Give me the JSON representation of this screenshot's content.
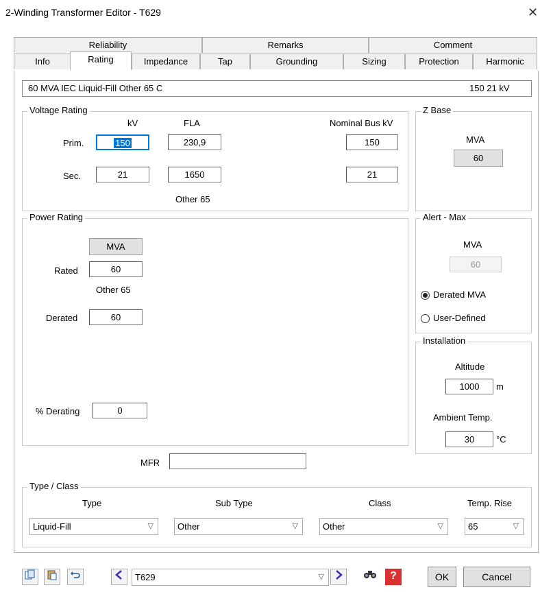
{
  "window": {
    "title": "2-Winding Transformer Editor - T629",
    "close_glyph": "✕"
  },
  "tabs_row1": [
    "Reliability",
    "Remarks",
    "Comment"
  ],
  "tabs_row2": [
    "Info",
    "Rating",
    "Impedance",
    "Tap",
    "Grounding",
    "Sizing",
    "Protection",
    "Harmonic"
  ],
  "summary": {
    "left": "60 MVA  IEC  Liquid-Fill  Other  65 C",
    "right": "150   21 kV"
  },
  "voltage_rating": {
    "title": "Voltage Rating",
    "col_kv": "kV",
    "col_fla": "FLA",
    "col_nominal": "Nominal Bus kV",
    "prim_label": "Prim.",
    "prim_kv": "150",
    "prim_fla": "230,9",
    "prim_nominal": "150",
    "sec_label": "Sec.",
    "sec_kv": "21",
    "sec_fla": "1650",
    "sec_nominal": "21",
    "note": "Other 65"
  },
  "z_base": {
    "title": "Z Base",
    "mva_label": "MVA",
    "mva_value": "60"
  },
  "power_rating": {
    "title": "Power Rating",
    "mva_button": "MVA",
    "rated_label": "Rated",
    "rated_value": "60",
    "note": "Other 65",
    "derated_label": "Derated",
    "derated_value": "60",
    "derating_label": "% Derating",
    "derating_value": "0"
  },
  "alert_max": {
    "title": "Alert - Max",
    "mva_label": "MVA",
    "mva_value": "60",
    "option_derated": "Derated MVA",
    "option_user": "User-Defined"
  },
  "installation": {
    "title": "Installation",
    "altitude_label": "Altitude",
    "altitude_value": "1000",
    "altitude_unit": "m",
    "ambient_label": "Ambient Temp.",
    "ambient_value": "30",
    "ambient_unit": "°C"
  },
  "mfr": {
    "label": "MFR",
    "value": ""
  },
  "type_class": {
    "title": "Type / Class",
    "type_label": "Type",
    "type_value": "Liquid-Fill",
    "subtype_label": "Sub Type",
    "subtype_value": "Other",
    "class_label": "Class",
    "class_value": "Other",
    "temprise_label": "Temp. Rise",
    "temprise_value": "65"
  },
  "footer": {
    "id_value": "T629",
    "ok": "OK",
    "cancel": "Cancel"
  }
}
